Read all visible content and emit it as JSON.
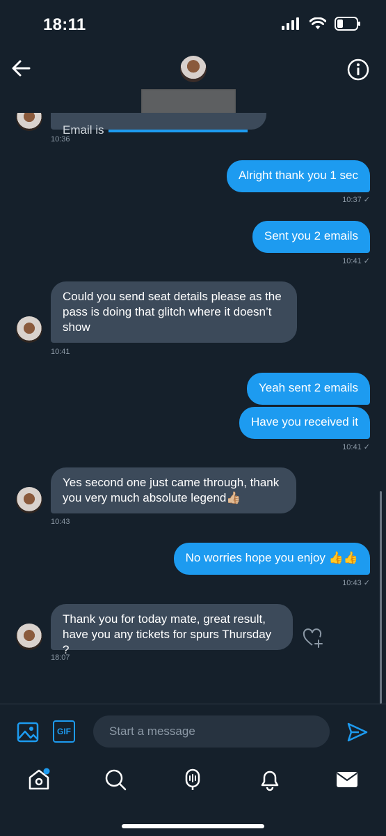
{
  "status": {
    "time": "18:11"
  },
  "header": {},
  "messages": [
    {
      "type": "in",
      "text": "Email is",
      "time": "10:36"
    },
    {
      "type": "out",
      "text": "Alright thank you 1 sec",
      "time": "10:37 ✓"
    },
    {
      "type": "out",
      "text": "Sent you 2 emails",
      "time": "10:41 ✓"
    },
    {
      "type": "in",
      "text": "Could you send seat details please as the pass is doing that glitch where it doesn’t show",
      "time": "10:41"
    },
    {
      "type": "out",
      "text": "Yeah sent 2 emails"
    },
    {
      "type": "out",
      "text": "Have you received it",
      "time": "10:41 ✓"
    },
    {
      "type": "in",
      "text": "Yes second one just came through, thank you very much absolute legend👍🏼",
      "time": "10:43"
    },
    {
      "type": "out",
      "text": "No worries hope you enjoy 👍👍",
      "time": "10:43 ✓"
    },
    {
      "type": "in",
      "text": "Thank you for today mate, great result, have you any tickets for spurs Thursday ?",
      "time": "18:07"
    }
  ],
  "compose": {
    "placeholder": "Start a message",
    "gif_label": "GIF"
  },
  "colors": {
    "accent": "#1d9bf0",
    "background": "#15202b",
    "incoming": "#3c4a5a"
  },
  "icons": [
    "back-arrow-icon",
    "info-icon",
    "image-icon",
    "gif-icon",
    "send-icon",
    "home-icon",
    "search-icon",
    "spaces-icon",
    "bell-icon",
    "mail-icon",
    "heart-plus-icon"
  ]
}
